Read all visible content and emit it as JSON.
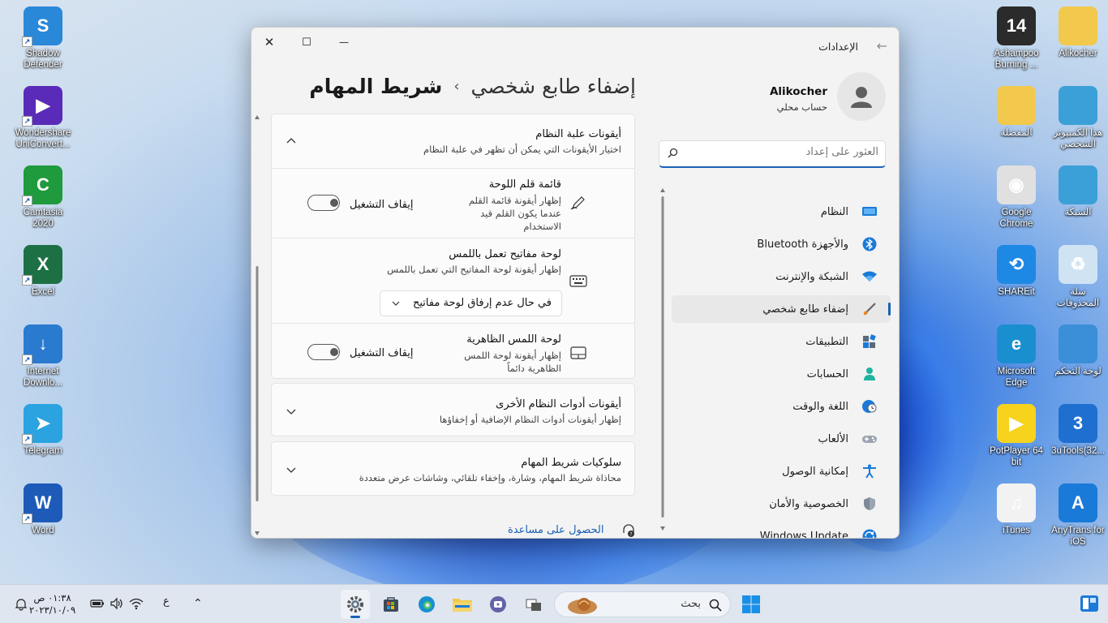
{
  "desktop": {
    "left_icons": [
      {
        "id": "shadow-defender",
        "label": "Shadow\nDefender",
        "color": "#2a88d8",
        "glyph": "S"
      },
      {
        "id": "uniconverter",
        "label": "Wondershare\nUniConvert...",
        "color": "#5a2bb8",
        "glyph": "▶"
      },
      {
        "id": "camtasia",
        "label": "Camtasia\n2020",
        "color": "#1f9a3c",
        "glyph": "C"
      },
      {
        "id": "excel",
        "label": "Excel",
        "color": "#1d7044",
        "glyph": "X"
      },
      {
        "id": "internet-download",
        "label": "Internet\nDownlo...",
        "color": "#2a7ad0",
        "glyph": "↓"
      },
      {
        "id": "telegram",
        "label": "Telegram",
        "color": "#2aa3e0",
        "glyph": "➤"
      },
      {
        "id": "word",
        "label": "Word",
        "color": "#1e5bb8",
        "glyph": "W"
      }
    ],
    "right_col1": [
      {
        "id": "ashampoo",
        "label": "Ashampoo\nBurning ...",
        "color": "#2b2b2b",
        "glyph": "14"
      },
      {
        "id": "favorites",
        "label": "المفضلة",
        "color": "#f2c94c",
        "glyph": ""
      },
      {
        "id": "chrome",
        "label": "Google\nChrome",
        "color": "#e0e0e0",
        "glyph": "◉"
      },
      {
        "id": "shareit",
        "label": "SHAREit",
        "color": "#1e88e5",
        "glyph": "⟲"
      },
      {
        "id": "edge",
        "label": "Microsoft\nEdge",
        "color": "#1a8fd0",
        "glyph": "e"
      },
      {
        "id": "potplayer",
        "label": "PotPlayer 64\nbit",
        "color": "#f7d31e",
        "glyph": "▶"
      },
      {
        "id": "itunes",
        "label": "iTunes",
        "color": "#f2f2f2",
        "glyph": "♫"
      }
    ],
    "right_col2": [
      {
        "id": "alikocher-folder",
        "label": "Alikocher",
        "color": "#f2c94c",
        "glyph": ""
      },
      {
        "id": "this-pc",
        "label": "هذا الكمبيوتر\nالشخصي",
        "color": "#3ba0d8",
        "glyph": ""
      },
      {
        "id": "network",
        "label": "الشبكة",
        "color": "#3ba0d8",
        "glyph": ""
      },
      {
        "id": "recycle-bin",
        "label": "سلة\nالمحذوفات",
        "color": "#cfe3f3",
        "glyph": "♻"
      },
      {
        "id": "control-panel",
        "label": "لوحة التحكم",
        "color": "#3a8fd8",
        "glyph": ""
      },
      {
        "id": "3utools",
        "label": "3uTools(32...",
        "color": "#1e6fd0",
        "glyph": "3"
      },
      {
        "id": "anytrans",
        "label": "AnyTrans for\niOS",
        "color": "#1a7ad8",
        "glyph": "A"
      }
    ]
  },
  "window": {
    "title": "الإعدادات",
    "back_glyph": "←",
    "controls": {
      "close": "✕",
      "maximize": "☐",
      "minimize": "—"
    }
  },
  "user": {
    "name": "Alikocher",
    "type": "حساب محلي"
  },
  "search": {
    "placeholder": "العثور على إعداد"
  },
  "nav": [
    {
      "label": "النظام",
      "icon": "system-icon"
    },
    {
      "label": "Bluetooth والأجهزة",
      "icon": "bluetooth-icon"
    },
    {
      "label": "الشبكة والإنترنت",
      "icon": "wifi-icon"
    },
    {
      "label": "إضفاء طابع شخصي",
      "icon": "brush-icon",
      "selected": true
    },
    {
      "label": "التطبيقات",
      "icon": "apps-icon"
    },
    {
      "label": "الحسابات",
      "icon": "accounts-icon"
    },
    {
      "label": "اللغة والوقت",
      "icon": "globe-clock-icon"
    },
    {
      "label": "الألعاب",
      "icon": "gamepad-icon"
    },
    {
      "label": "إمكانية الوصول",
      "icon": "accessibility-icon"
    },
    {
      "label": "الخصوصية والأمان",
      "icon": "shield-icon"
    },
    {
      "label": "Windows Update",
      "icon": "update-icon"
    }
  ],
  "page": {
    "crumb": "إضفاء طابع شخصي",
    "separator": "›",
    "title": "شريط المهام"
  },
  "sections": {
    "system_tray": {
      "title": "أيقونات علبة النظام",
      "desc": "اختيار الأيقونات التي يمكن أن تظهر في علبة النظام",
      "items": [
        {
          "title": "قائمة قلم اللوحة",
          "desc": "إظهار أيقونة قائمة القلم عندما يكون القلم قيد الاستخدام",
          "state": "إيقاف التشغيل"
        },
        {
          "title": "لوحة مفاتيح تعمل باللمس",
          "desc": "إظهار أيقونة لوحة المفاتيح التي تعمل باللمس",
          "dropdown": "في حال عدم إرفاق لوحة مفاتيح"
        },
        {
          "title": "لوحة اللمس الظاهرية",
          "desc": "إظهار أيقونة لوحة اللمس الظاهرية دائماً",
          "state": "إيقاف التشغيل"
        }
      ]
    },
    "other_icons": {
      "title": "أيقونات أدوات النظام الأخرى",
      "desc": "إظهار أيقونات أدوات النظام الإضافية أو إخفاؤها"
    },
    "behaviors": {
      "title": "سلوكيات شريط المهام",
      "desc": "محاذاة شريط المهام، وشارة، وإخفاء تلقائي، وشاشات عرض متعددة"
    }
  },
  "help": {
    "label": "الحصول على مساعدة"
  },
  "taskbar": {
    "search_label": "بحث",
    "time": "٠١:٣٨ ص",
    "date": "٢٠٢٣/١٠/٠٩",
    "lang": "ع",
    "chevron": "⌃"
  }
}
